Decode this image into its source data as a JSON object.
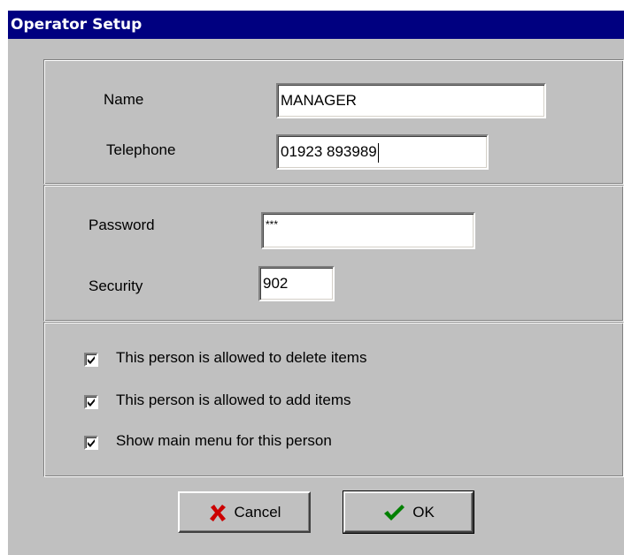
{
  "window": {
    "title": "Operator Setup"
  },
  "operator": {
    "name_label": "Name",
    "name_value": "MANAGER",
    "telephone_label": "Telephone",
    "telephone_value": "01923 893989"
  },
  "security": {
    "password_label": "Password",
    "password_value": "***",
    "security_label": "Security",
    "security_value": "902"
  },
  "permissions": [
    {
      "label": "This person is allowed to delete items",
      "checked": true
    },
    {
      "label": "This person is allowed to add items",
      "checked": true
    },
    {
      "label": "Show main menu for this person",
      "checked": true
    }
  ],
  "buttons": {
    "cancel_label": "Cancel",
    "cancel_icon": "red-x-icon",
    "ok_label": "OK",
    "ok_icon": "green-checkmark-icon"
  },
  "colors": {
    "titlebar": "#000080",
    "dialog_bg": "#c0c0c0",
    "cancel_icon": "#cc0000",
    "ok_icon": "#008000"
  }
}
